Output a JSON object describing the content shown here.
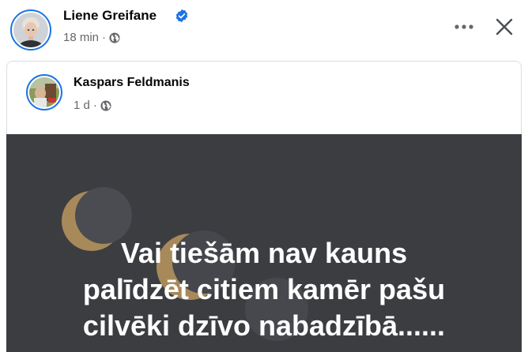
{
  "post": {
    "author": "Liene Greifane",
    "time": "18 min",
    "verified": true
  },
  "shared_post": {
    "author": "Kaspars Feldmanis",
    "time": "1 d"
  },
  "image_text": {
    "line1": "Vai tiešām nav kauns",
    "line2": "palīdzēt citiem kamēr pašu",
    "line3": "cilvēki dzīvo nabadzībā......"
  },
  "icons": {
    "verified": "verified-badge-icon",
    "privacy": "globe-icon",
    "more": "more-horizontal-icon",
    "close": "close-icon"
  },
  "colors": {
    "verified_blue": "#1b74e4",
    "meta_gray": "#65676b",
    "image_background": "#3b3d41",
    "moon_gold": "#a8895a"
  }
}
